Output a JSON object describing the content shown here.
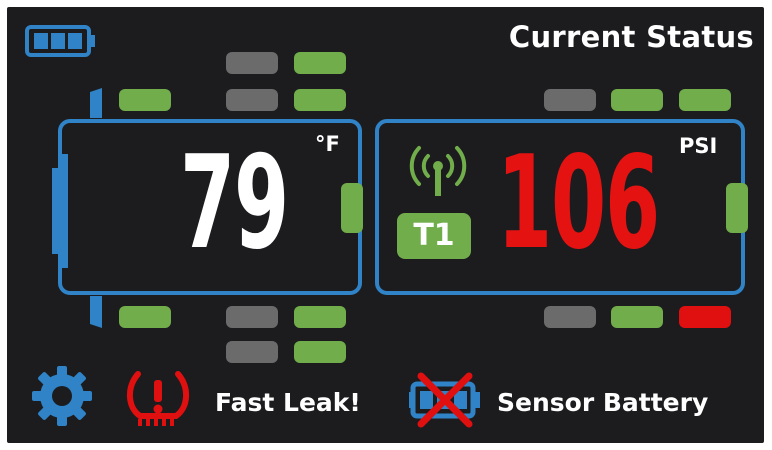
{
  "header": {
    "title": "Current Status"
  },
  "status_bar": {
    "battery_icon": "battery-icon",
    "battery_level_bars": 3
  },
  "temperature": {
    "value": "79",
    "unit": "°F"
  },
  "pressure": {
    "value": "106",
    "unit": "PSI",
    "sensor_label": "T1",
    "signal_icon": "signal-antenna-icon"
  },
  "alerts": {
    "settings_icon": "gear-icon",
    "fast_leak_icon": "tire-pressure-warning-icon",
    "fast_leak_label": "Fast Leak!",
    "sensor_battery_icon": "battery-crossed-icon",
    "sensor_battery_label": "Sensor Battery"
  },
  "colors": {
    "background": "#1c1c1f",
    "panel_border": "#2f83c6",
    "ok": "#71ad4b",
    "inactive": "#6b6b6b",
    "alarm": "#e01010",
    "text": "#ffffff"
  }
}
